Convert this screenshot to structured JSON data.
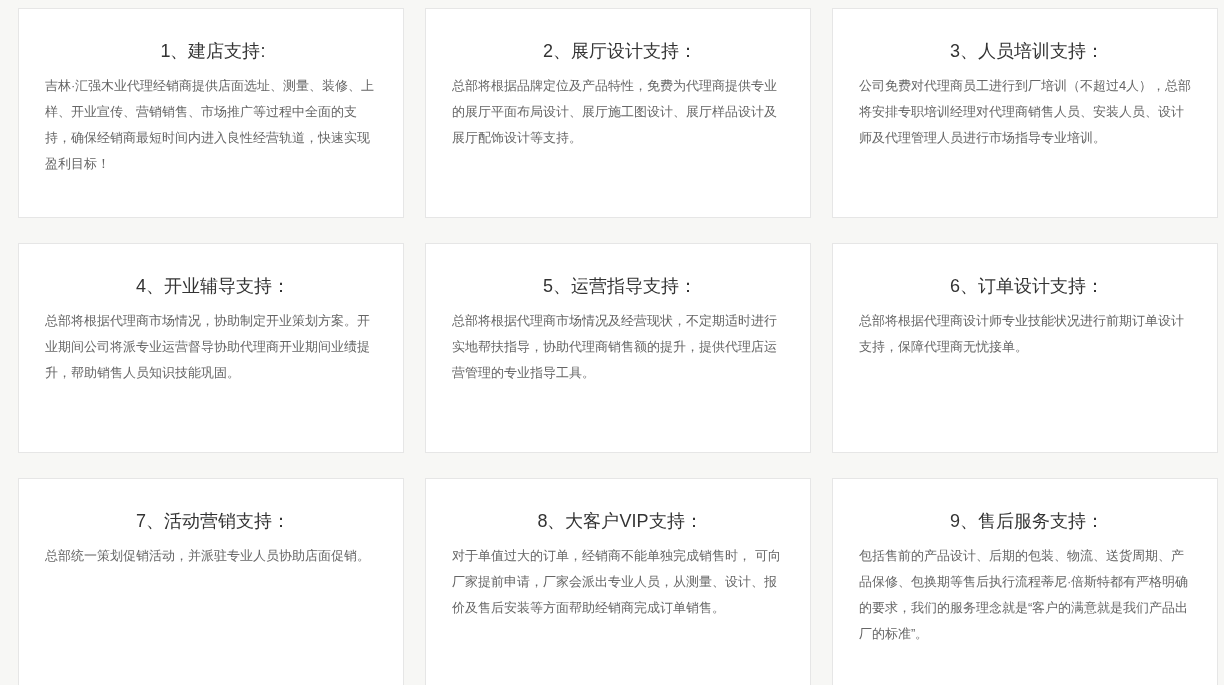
{
  "cards": [
    {
      "title": "1、建店支持:",
      "body": "吉林·汇强木业代理经销商提供店面选址、测量、装修、上样、开业宣传、营销销售、市场推广等过程中全面的支持，确保经销商最短时间内进入良性经营轨道，快速实现盈利目标！"
    },
    {
      "title": "2、展厅设计支持：",
      "body": "总部将根据品牌定位及产品特性，免费为代理商提供专业的展厅平面布局设计、展厅施工图设计、展厅样品设计及展厅配饰设计等支持。"
    },
    {
      "title": "3、人员培训支持：",
      "body": "公司免费对代理商员工进行到厂培训（不超过4人），总部将安排专职培训经理对代理商销售人员、安装人员、设计师及代理管理人员进行市场指导专业培训。"
    },
    {
      "title": "4、开业辅导支持：",
      "body": "总部将根据代理商市场情况，协助制定开业策划方案。开业期间公司将派专业运营督导协助代理商开业期间业绩提升，帮助销售人员知识技能巩固。"
    },
    {
      "title": "5、运营指导支持：",
      "body": "总部将根据代理商市场情况及经营现状，不定期适时进行实地帮扶指导，协助代理商销售额的提升，提供代理店运营管理的专业指导工具。"
    },
    {
      "title": "6、订单设计支持：",
      "body": "总部将根据代理商设计师专业技能状况进行前期订单设计支持，保障代理商无忧接单。"
    },
    {
      "title": "7、活动营销支持：",
      "body": "总部统一策划促销活动，并派驻专业人员协助店面促销。"
    },
    {
      "title": "8、大客户VIP支持：",
      "body": "对于单值过大的订单，经销商不能单独完成销售时， 可向厂家提前申请，厂家会派出专业人员，从测量、设计、报价及售后安装等方面帮助经销商完成订单销售。"
    },
    {
      "title": "9、售后服务支持：",
      "body": "包括售前的产品设计、后期的包装、物流、送货周期、产品保修、包换期等售后执行流程蒂尼·倍斯特都有严格明确的要求，我们的服务理念就是“客户的满意就是我们产品出厂的标准”。"
    }
  ]
}
